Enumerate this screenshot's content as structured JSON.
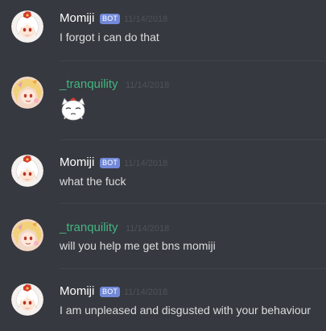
{
  "messages": [
    {
      "author": "Momiji",
      "author_color": "#ffffff",
      "avatar_icon": "momiji-avatar-icon",
      "bot_tag": "BOT",
      "timestamp": "11/14/2018",
      "text": "I forgot i can do that"
    },
    {
      "author": "_tranquility",
      "author_color": "#43b581",
      "avatar_icon": "tranquility-avatar-icon",
      "timestamp": "11/14/2018",
      "emoji_icon": "momiji-face-emoji-icon"
    },
    {
      "author": "Momiji",
      "author_color": "#ffffff",
      "avatar_icon": "momiji-avatar-icon",
      "bot_tag": "BOT",
      "timestamp": "11/14/2018",
      "text": "what the fuck"
    },
    {
      "author": "_tranquility",
      "author_color": "#43b581",
      "avatar_icon": "tranquility-avatar-icon",
      "timestamp": "11/14/2018",
      "text": "will you help me get bns momiji"
    },
    {
      "author": "Momiji",
      "author_color": "#ffffff",
      "avatar_icon": "momiji-avatar-icon",
      "bot_tag": "BOT",
      "timestamp": "11/14/2018",
      "text": "I am unpleased and disgusted with your behaviour"
    }
  ],
  "colors": {
    "background": "#36393f",
    "bot_tag_bg": "#7289da",
    "message_text": "#dcddde",
    "timestamp": "#4f5359",
    "divider": "#41444a"
  }
}
